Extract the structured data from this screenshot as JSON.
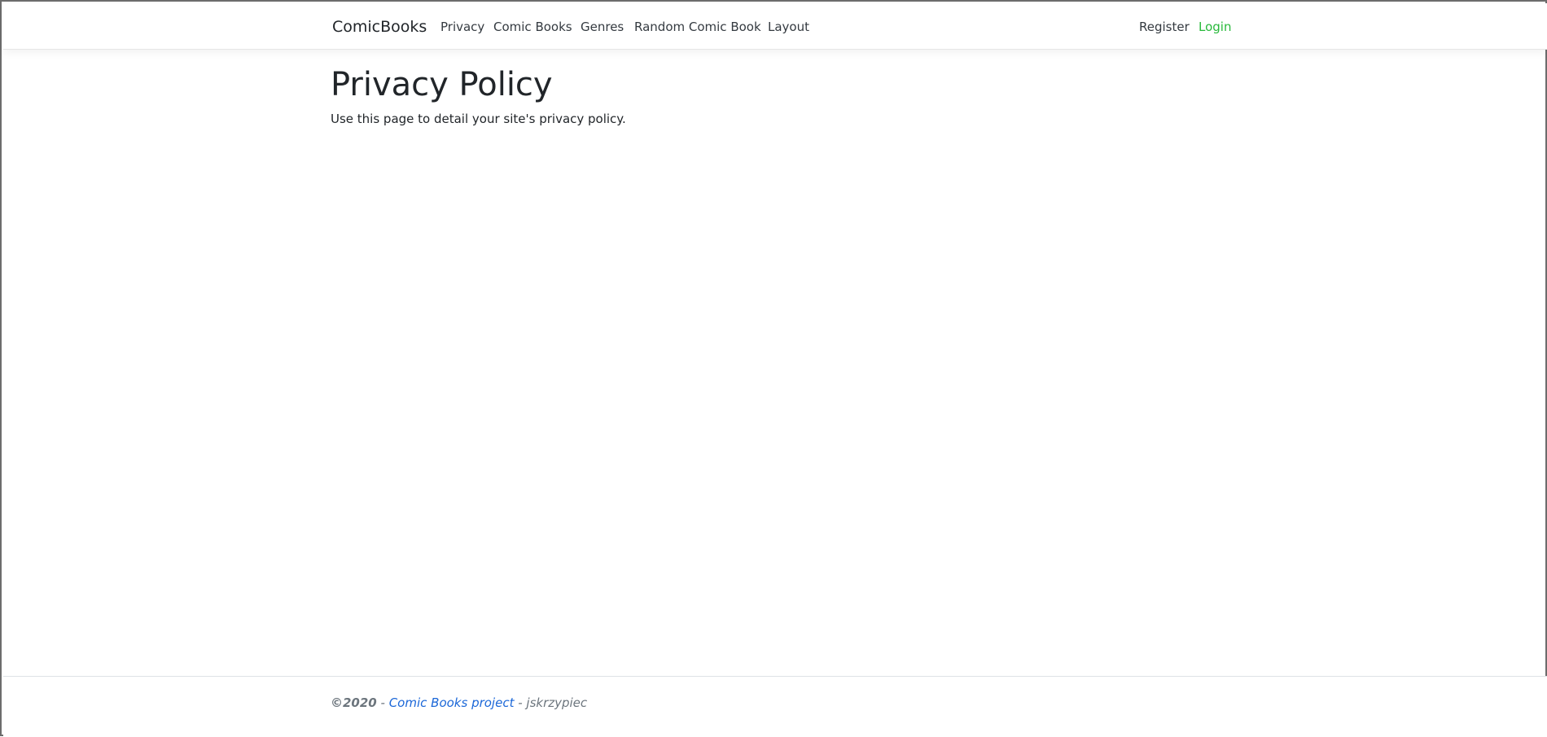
{
  "navbar": {
    "brand": "ComicBooks",
    "links": [
      {
        "label": "Privacy"
      },
      {
        "label": "Comic Books"
      },
      {
        "label": "Genres"
      },
      {
        "label": "Random Comic Book"
      },
      {
        "label": "Layout"
      }
    ],
    "auth": {
      "register": "Register",
      "login": "Login"
    }
  },
  "main": {
    "title": "Privacy Policy",
    "description": "Use this page to detail your site's privacy policy."
  },
  "footer": {
    "copyright": "©2020",
    "separator1": " - ",
    "project_link": "Comic Books project",
    "separator2": " - ",
    "author": "jskrzypiec"
  },
  "colors": {
    "login_link": "#28b93b",
    "footer_link": "#1b67d8",
    "footer_text": "#6c757d",
    "page_border": "#6c6c6c"
  }
}
